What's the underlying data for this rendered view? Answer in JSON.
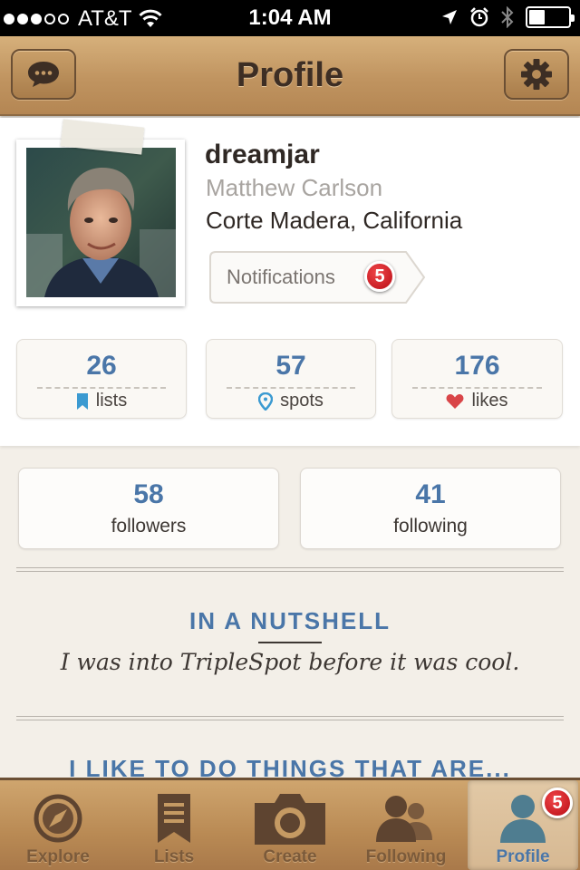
{
  "status_bar": {
    "carrier": "AT&T",
    "time": "1:04 AM",
    "signal_bars_filled": 3,
    "signal_bars_total": 5,
    "battery_level": 0.4,
    "icons": [
      "wifi-icon",
      "location-arrow-icon",
      "alarm-icon",
      "bluetooth-icon",
      "battery-icon"
    ]
  },
  "nav": {
    "title": "Profile",
    "left_icon": "chat-bubble-icon",
    "right_icon": "gear-icon"
  },
  "profile": {
    "username": "dreamjar",
    "full_name": "Matthew Carlson",
    "location": "Corte Madera, California",
    "notifications_label": "Notifications",
    "notifications_count": "5"
  },
  "stats": [
    {
      "count": "26",
      "label": "lists",
      "icon": "bookmark-icon",
      "icon_color": "#3b9ad1"
    },
    {
      "count": "57",
      "label": "spots",
      "icon": "map-pin-icon",
      "icon_color": "#3b9ad1"
    },
    {
      "count": "176",
      "label": "likes",
      "icon": "heart-icon",
      "icon_color": "#d94548"
    }
  ],
  "follow": [
    {
      "count": "58",
      "label": "followers"
    },
    {
      "count": "41",
      "label": "following"
    }
  ],
  "sections": {
    "nutshell_title": "IN A NUTSHELL",
    "nutshell_text": "I was into TripleSpot before it was cool.",
    "like_title": "I LIKE TO DO THINGS THAT ARE..."
  },
  "tabs": [
    {
      "label": "Explore",
      "icon": "compass-icon",
      "active": false
    },
    {
      "label": "Lists",
      "icon": "list-ribbon-icon",
      "active": false
    },
    {
      "label": "Create",
      "icon": "camera-icon",
      "active": false
    },
    {
      "label": "Following",
      "icon": "people-icon",
      "active": false
    },
    {
      "label": "Profile",
      "icon": "person-icon",
      "active": true,
      "badge": "5"
    }
  ],
  "colors": {
    "accent_blue": "#4a76a8",
    "nav_brown": "#c09460",
    "badge_red": "#d0141c"
  }
}
